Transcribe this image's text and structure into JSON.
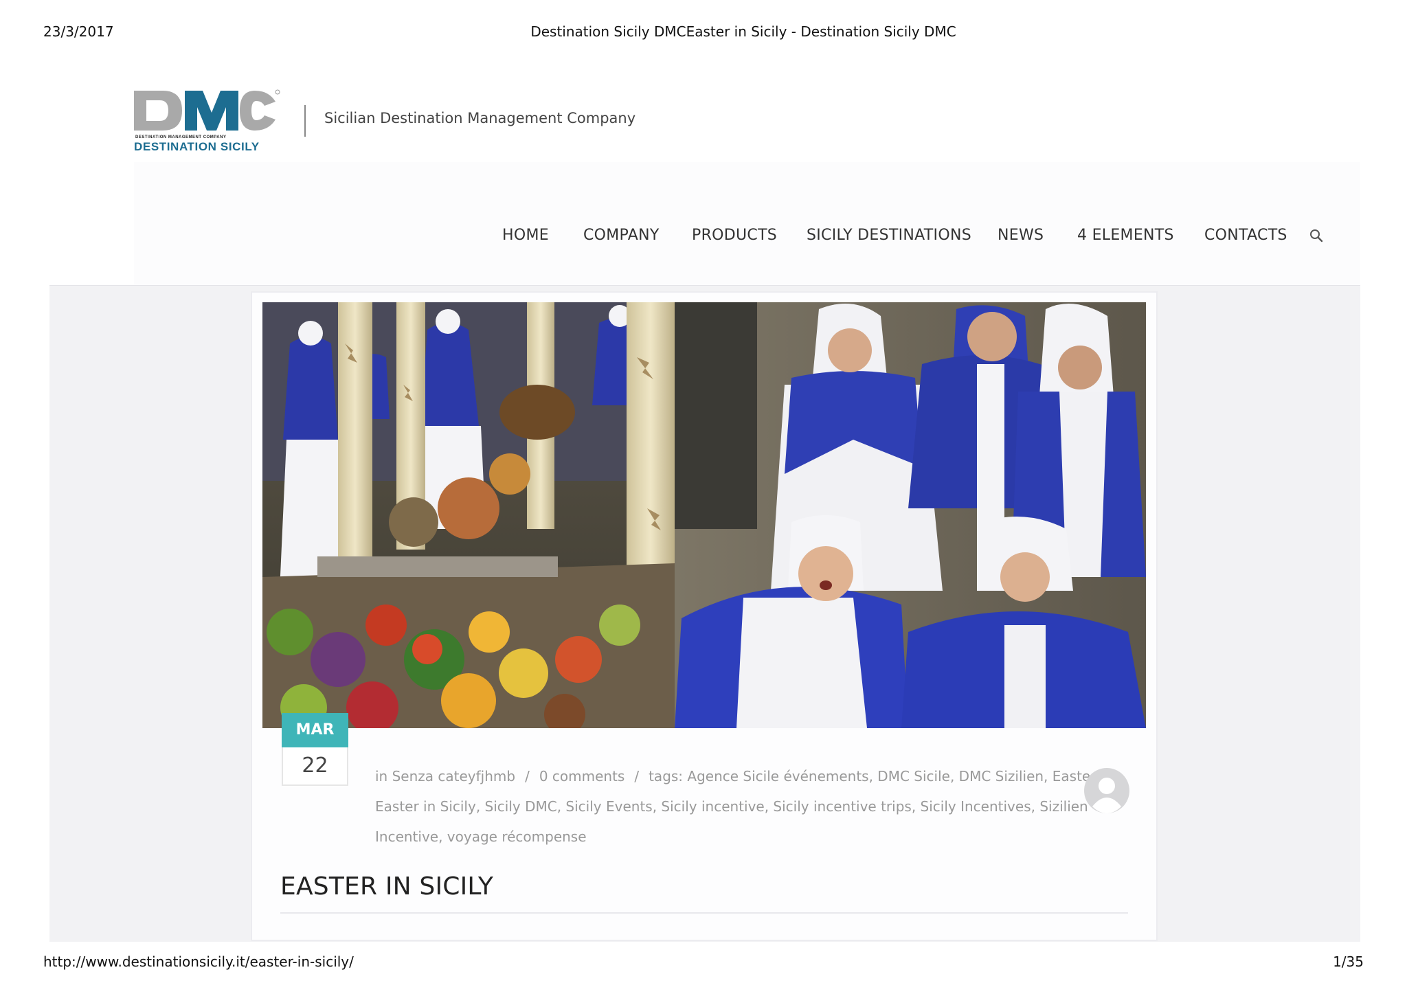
{
  "print": {
    "date": "23/3/2017",
    "title": "Destination Sicily DMCEaster in Sicily - Destination Sicily DMC",
    "url": "http://www.destinationsicily.it/easter-in-sicily/",
    "page": "1/35"
  },
  "brand": {
    "logo_letters": "DMC",
    "logo_line1": "DESTINATION MANAGEMENT COMPANY",
    "logo_line2": "DESTINATION SICILY",
    "tagline": "Sicilian Destination Management Company",
    "colors": {
      "gray": "#a9a9a9",
      "blue": "#1d6d91",
      "accent": "#3fb5b8"
    }
  },
  "nav": {
    "items": [
      {
        "label": "HOME"
      },
      {
        "label": "COMPANY"
      },
      {
        "label": "PRODUCTS"
      },
      {
        "label": "SICILY DESTINATIONS"
      },
      {
        "label": "NEWS"
      },
      {
        "label": "4 ELEMENTS"
      },
      {
        "label": "CONTACTS"
      }
    ],
    "search_icon": "search-icon"
  },
  "post": {
    "date": {
      "month": "MAR",
      "day": "22"
    },
    "meta": {
      "category": "in Senza cateyfjhmb",
      "comments": "0 comments",
      "tags": "tags: Agence Sicile événements, DMC Sicile, DMC Sizilien, Easter, Easter in Sicily, Sicily DMC, Sicily Events, Sicily incentive, Sicily incentive trips, Sicily Incentives, Sizilien Incentive, voyage récompense"
    },
    "title": "EASTER IN SICILY"
  }
}
